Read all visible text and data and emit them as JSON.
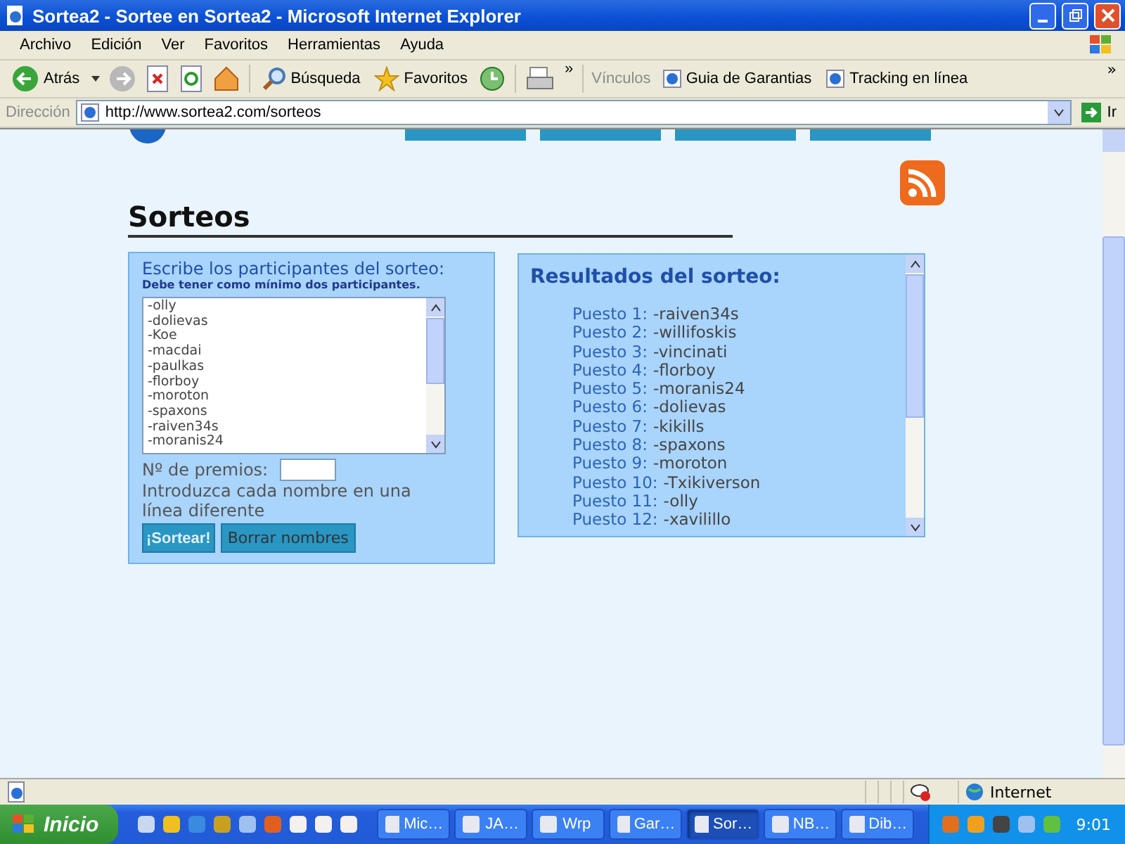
{
  "window": {
    "title": "Sortea2 - Sortee en Sortea2 - Microsoft Internet Explorer"
  },
  "menu": [
    "Archivo",
    "Edición",
    "Ver",
    "Favoritos",
    "Herramientas",
    "Ayuda"
  ],
  "toolbar": {
    "back": "Atrás",
    "search": "Búsqueda",
    "favorites": "Favoritos",
    "chevron": "»",
    "links_label": "Vínculos",
    "links": [
      "Guia de Garantias",
      "Tracking en línea"
    ],
    "links_chevron": "»"
  },
  "address": {
    "label": "Dirección",
    "url": "http://www.sortea2.com/sorteos",
    "go": "Ir"
  },
  "page": {
    "heading": "Sorteos",
    "form": {
      "title": "Escribe los participantes del sorteo:",
      "note": "Debe tener como mínimo dos participantes.",
      "participants": [
        "-olly",
        "-dolievas",
        "-Koe",
        "-macdai",
        "-paulkas",
        "-florboy",
        "-moroton",
        "-spaxons",
        "-raiven34s",
        "-moranis24"
      ],
      "prizes_label": "Nº de premios:",
      "hint": "Introduzca cada nombre en una línea diferente",
      "buttons": [
        "¡Sortear!",
        "Borrar nombres"
      ]
    },
    "results": {
      "title": "Resultados del sorteo:",
      "items": [
        {
          "label": "Puesto 1:",
          "name": "-raiven34s"
        },
        {
          "label": "Puesto 2:",
          "name": "-willifoskis"
        },
        {
          "label": "Puesto 3:",
          "name": "-vincinati"
        },
        {
          "label": "Puesto 4:",
          "name": "-florboy"
        },
        {
          "label": "Puesto 5:",
          "name": "-moranis24"
        },
        {
          "label": "Puesto 6:",
          "name": "-dolievas"
        },
        {
          "label": "Puesto 7:",
          "name": "-kikills"
        },
        {
          "label": "Puesto 8:",
          "name": "-spaxons"
        },
        {
          "label": "Puesto 9:",
          "name": "-moroton"
        },
        {
          "label": "Puesto 10:",
          "name": "-Txikiverson"
        },
        {
          "label": "Puesto 11:",
          "name": "-olly"
        },
        {
          "label": "Puesto 12:",
          "name": "-xavilillo"
        }
      ]
    }
  },
  "status_bar": {
    "zone": "Internet"
  },
  "taskbar": {
    "start": "Inicio",
    "tasks": [
      {
        "label": "Mic…",
        "selected": false
      },
      {
        "label": "JA…",
        "selected": false
      },
      {
        "label": "Wrp",
        "selected": false
      },
      {
        "label": "Gar…",
        "selected": false
      },
      {
        "label": "Sor…",
        "selected": true
      },
      {
        "label": "NB…",
        "selected": false
      },
      {
        "label": "Dib…",
        "selected": false
      }
    ],
    "clock": "9:01"
  }
}
